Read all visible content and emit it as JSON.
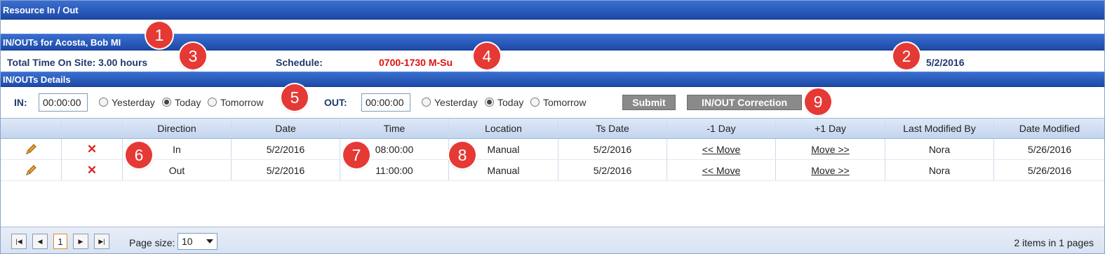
{
  "header": {
    "title": "Resource In / Out"
  },
  "inout_header": {
    "title": "IN/OUTs for Acosta, Bob MI"
  },
  "summary": {
    "total_time": "Total Time On Site: 3.00 hours",
    "schedule_label": "Schedule:",
    "schedule_value": "0700-1730 M-Su",
    "date": "5/2/2016"
  },
  "details_header": {
    "title": "IN/OUTs Details"
  },
  "controls": {
    "in_label": "IN:",
    "in_value": "00:00:00",
    "out_label": "OUT:",
    "out_value": "00:00:00",
    "radio_yesterday": "Yesterday",
    "radio_today": "Today",
    "radio_tomorrow": "Tomorrow",
    "in_selected": "Today",
    "out_selected": "Today",
    "submit": "Submit",
    "correction": "IN/OUT Correction"
  },
  "table": {
    "columns": [
      "",
      "",
      "Direction",
      "Date",
      "Time",
      "Location",
      "Ts Date",
      "-1 Day",
      "+1 Day",
      "Last Modified By",
      "Date Modified"
    ],
    "rows": [
      {
        "direction": "In",
        "date": "5/2/2016",
        "time": "08:00:00",
        "location": "Manual",
        "ts_date": "5/2/2016",
        "minus_day": "<< Move",
        "plus_day": "Move >>",
        "modified_by": "Nora",
        "date_modified": "5/26/2016"
      },
      {
        "direction": "Out",
        "date": "5/2/2016",
        "time": "11:00:00",
        "location": "Manual",
        "ts_date": "5/2/2016",
        "minus_day": "<< Move",
        "plus_day": "Move >>",
        "modified_by": "Nora",
        "date_modified": "5/26/2016"
      }
    ]
  },
  "pager": {
    "current_page": "1",
    "page_size_label": "Page size:",
    "page_size": "10",
    "info": "2 items in 1 pages"
  },
  "callouts": [
    "1",
    "2",
    "3",
    "4",
    "5",
    "6",
    "7",
    "8",
    "9"
  ],
  "colors": {
    "header_blue": "#1d4aa8",
    "schedule_red": "#e01010",
    "callout_red": "#e53935"
  }
}
